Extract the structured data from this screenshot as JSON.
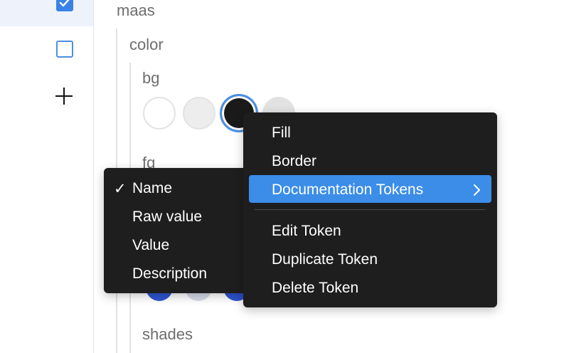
{
  "tree": {
    "root": "maas",
    "group": "color",
    "subgroups": {
      "bg": "bg",
      "fg": "fg",
      "shades": "shades"
    }
  },
  "swatches": {
    "colors": [
      "#ffffff",
      "#ededed",
      "#1a1a1a",
      "#e2e2e2"
    ],
    "selected_border": "#4a90e2"
  },
  "column_menu": {
    "check_glyph": "✓",
    "items": [
      "Name",
      "Raw value",
      "Value",
      "Description"
    ],
    "checked": "Name"
  },
  "context_menu": {
    "items": [
      "Fill",
      "Border",
      "Documentation Tokens"
    ],
    "highlighted": "Documentation Tokens",
    "submenu_arrow": "›",
    "actions": [
      "Edit Token",
      "Duplicate Token",
      "Delete Token"
    ]
  },
  "colors": {
    "menu_bg": "#1e1e1e",
    "highlight": "#3b8de8",
    "accent": "#3b82e6",
    "label": "#6e6e6e"
  }
}
